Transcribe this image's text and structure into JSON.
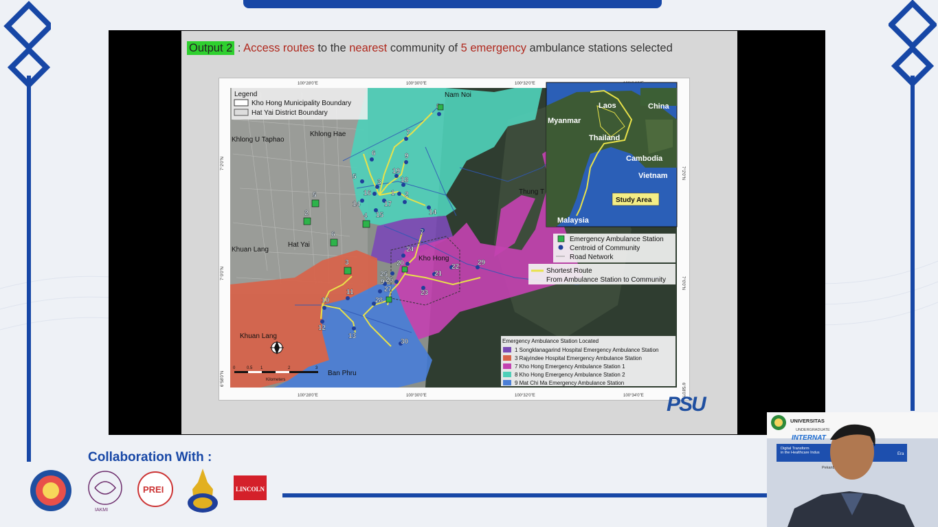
{
  "slide": {
    "output_tag": "Output 2",
    "title_parts": [
      {
        "text": " : ",
        "color": "#333333"
      },
      {
        "text": "Access routes",
        "color": "#b0291e"
      },
      {
        "text": " to the ",
        "color": "#333333"
      },
      {
        "text": "nearest",
        "color": "#b0291e"
      },
      {
        "text": " community of ",
        "color": "#333333"
      },
      {
        "text": "5 emergency",
        "color": "#b0291e"
      },
      {
        "text": " ambulance stations selected",
        "color": "#333333"
      }
    ],
    "psu_logo": "PSU"
  },
  "map": {
    "top_coords": [
      "100°28'0\"E",
      "100°30'0\"E",
      "100°32'0\"E",
      "100°34'0\"E"
    ],
    "bottom_coords": [
      "100°28'0\"E",
      "100°30'0\"E",
      "100°32'0\"E",
      "100°34'0\"E"
    ],
    "left_coords": [
      "7°2'0\"N",
      "7°0'0\"N",
      "6°58'0\"N"
    ],
    "right_coords": [
      "7°2'0\"N",
      "7°0'0\"N",
      "6°58'0\"N"
    ],
    "legend": {
      "title": "Legend",
      "items": [
        "Kho Hong Municipality Boundary",
        "Hat Yai District Boundary"
      ]
    },
    "place_names": [
      {
        "text": "Nam Noi"
      },
      {
        "text": "Khlong U Taphao"
      },
      {
        "text": "Khlong Hae"
      },
      {
        "text": "Hat Yai"
      },
      {
        "text": "Khuan Lang"
      },
      {
        "text": "Kho Hong"
      },
      {
        "text": "Thung T"
      },
      {
        "text": "Khuan Lang"
      },
      {
        "text": "Ban Phru"
      }
    ],
    "point_legend": [
      "Emergency Ambulance Station",
      "Centroid of Community",
      "Road Network"
    ],
    "route_legend": [
      "Shortest Route",
      "From Ambulance Station to Community"
    ],
    "station_legend": {
      "title": "Emergency Ambulance Station Located",
      "items": [
        {
          "label": "1 Songklanagarind Hospital Emergency Ambulance Station",
          "color": "#7b4bb5"
        },
        {
          "label": "3 Rajyindee Hospital Emergency Ambulance Station",
          "color": "#d8634a"
        },
        {
          "label": "7 Kho Hong Emergency Ambulance Station 1",
          "color": "#c242b0"
        },
        {
          "label": "8 Kho Hong Emergency Ambulance Station 2",
          "color": "#4fcfb8"
        },
        {
          "label": "9 Mat Chi Ma Emergency Ambulance Station",
          "color": "#4a7ed6"
        }
      ]
    },
    "scale_bar": {
      "ticks": [
        "0",
        "0.5",
        "1",
        "2",
        "3"
      ],
      "unit": "Kilometers"
    },
    "inset": {
      "labels": [
        "Laos",
        "China",
        "Myanmar",
        "Thailand",
        "Cambodia",
        "Vietnam",
        "Malaysia"
      ],
      "study_area": "Study Area"
    },
    "community_labels": [
      "8",
      "7",
      "6",
      "9",
      "5",
      "19",
      "3",
      "18",
      "16",
      "1",
      "14",
      "17",
      "2",
      "15",
      "14",
      "7",
      "24",
      "20",
      "25",
      "21",
      "22",
      "29",
      "9",
      "26",
      "23",
      "27",
      "28",
      "11",
      "10",
      "12",
      "13",
      "30"
    ],
    "station_labels": [
      "5",
      "2",
      "4",
      "6",
      "3"
    ]
  },
  "footer": {
    "collab_title": "Collaboration With :",
    "logos": [
      {
        "name": "university-seal",
        "text": ""
      },
      {
        "name": "iakmi-logo",
        "text": "IAKMI"
      },
      {
        "name": "prei-logo",
        "text": "PREI"
      },
      {
        "name": "thai-emblem-logo",
        "text": ""
      },
      {
        "name": "lincoln-logo",
        "text": "LINCOLN"
      }
    ]
  },
  "webcam": {
    "banner_title": "UNIVERSITAS",
    "banner_sub": "UNDERGRADUATE",
    "inter_text": "INTERNAT",
    "blue_line1": "Digital Transform",
    "blue_line2": "in the Healthcare Indus",
    "blue_right": "Era",
    "pek": "Pekanb"
  },
  "colors": {
    "primary_blue": "#1747a6",
    "purple_zone": "#7b4bb5",
    "orange_zone": "#d8634a",
    "magenta_zone": "#c242b0",
    "teal_zone": "#4fcfb8",
    "blue_zone": "#4a7ed6",
    "route": "#e9e24a",
    "station_green": "#2db34a",
    "centroid": "#1f3f9a"
  }
}
